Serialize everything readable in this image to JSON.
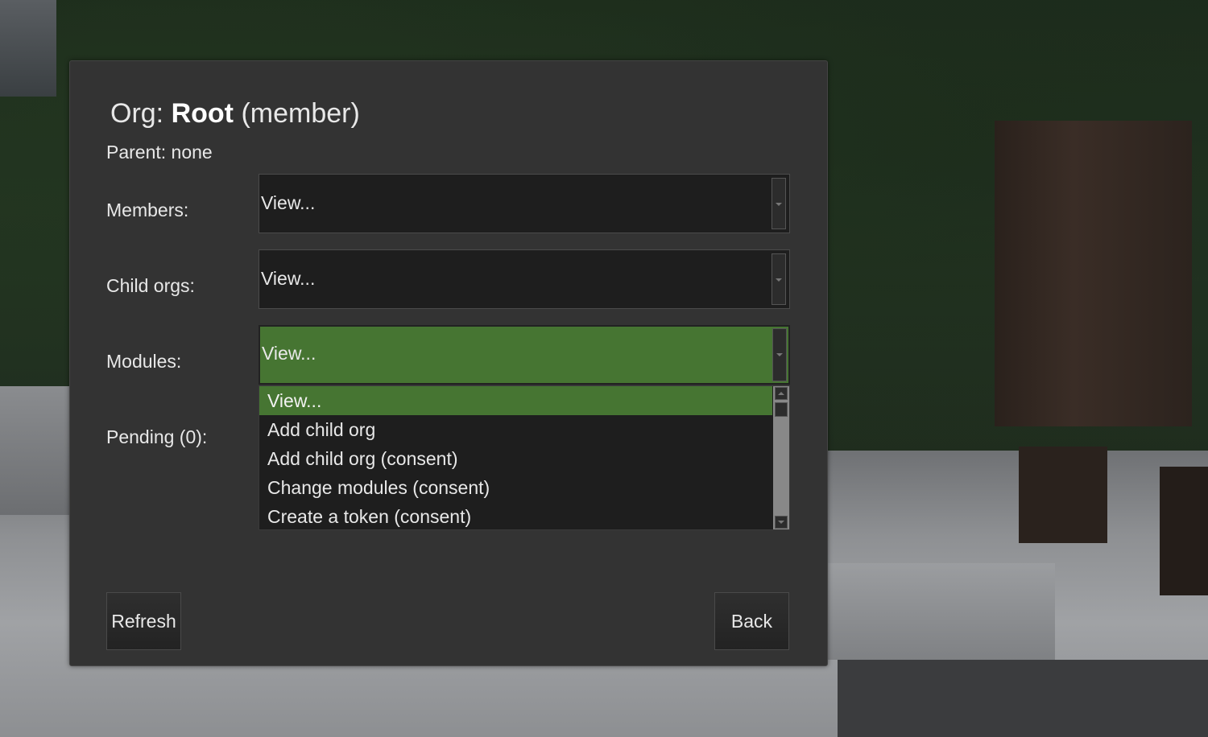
{
  "dialog": {
    "title_prefix": "Org: ",
    "title_name": "Root",
    "title_suffix": " (member)",
    "parent_text": "Parent: none"
  },
  "rows": {
    "members": {
      "label": "Members:",
      "value": "View..."
    },
    "child_orgs": {
      "label": "Child orgs:",
      "value": "View..."
    },
    "modules": {
      "label": "Modules:",
      "value": "View..."
    },
    "pending": {
      "label": "Pending (0):"
    }
  },
  "modules_dropdown_options": [
    {
      "label": "View...",
      "selected": true
    },
    {
      "label": "Add child org",
      "selected": false
    },
    {
      "label": "Add child org (consent)",
      "selected": false
    },
    {
      "label": "Change modules (consent)",
      "selected": false
    },
    {
      "label": "Create a token (consent)",
      "selected": false
    }
  ],
  "buttons": {
    "refresh": "Refresh",
    "back": "Back"
  },
  "colors": {
    "dialog_bg": "#333333",
    "highlight_green": "#467532",
    "field_bg": "#1e1e1e"
  }
}
